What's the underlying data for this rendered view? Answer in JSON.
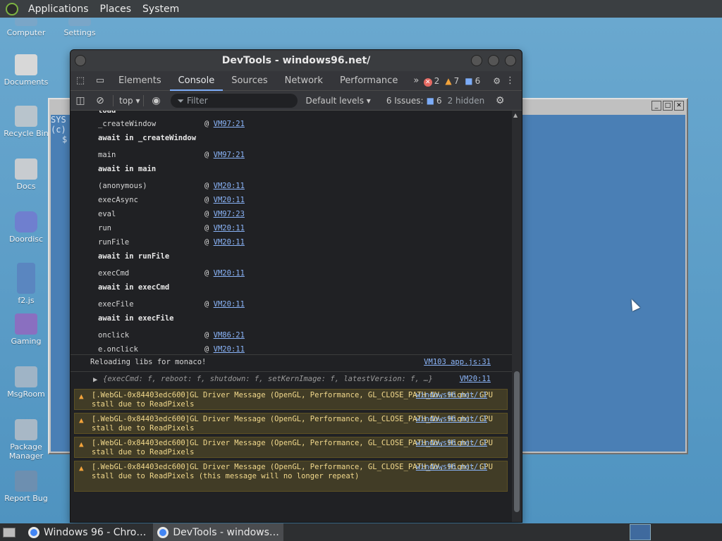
{
  "top_panel": {
    "menus": [
      "Applications",
      "Places",
      "System"
    ]
  },
  "desktop_icons": [
    {
      "label": "Computer"
    },
    {
      "label": "Settings"
    },
    {
      "label": "Documents"
    },
    {
      "label": "Recycle Bin"
    },
    {
      "label": "Docs"
    },
    {
      "label": "Doordisc"
    },
    {
      "label": "f2.js"
    },
    {
      "label": "Gaming"
    },
    {
      "label": "MsgRoom"
    },
    {
      "label": "Package Manager"
    },
    {
      "label": "Report Bug"
    }
  ],
  "w96_window": {
    "terminal_lines": [
      "SYS",
      "(c)",
      "",
      "$"
    ],
    "buttons": [
      "_",
      "□",
      "✕"
    ]
  },
  "devtools": {
    "title": "DevTools - windows96.net/",
    "tabs": [
      "Elements",
      "Console",
      "Sources",
      "Network",
      "Performance"
    ],
    "active_tab": "Console",
    "more_tabs": "»",
    "error_count": "2",
    "warning_count": "7",
    "info_count": "6",
    "toolbar": {
      "context": "top ▾",
      "filter_placeholder": "Filter",
      "levels": "Default levels ▾",
      "issues_label": "6 Issues:",
      "issues_count": "6",
      "hidden": "2 hidden"
    },
    "stack": [
      {
        "fn": "_createWindow",
        "link": "VM97:21"
      },
      {
        "await": "await in _createWindow"
      },
      {
        "fn": "main",
        "link": "VM97:21"
      },
      {
        "await": "await in main"
      },
      {
        "fn": "(anonymous)",
        "link": "VM20:11"
      },
      {
        "fn": "execAsync",
        "link": "VM20:11"
      },
      {
        "fn": "eval",
        "link": "VM97:23"
      },
      {
        "fn": "run",
        "link": "VM20:11"
      },
      {
        "fn": "runFile",
        "link": "VM20:11"
      },
      {
        "await": "await in runFile"
      },
      {
        "fn": "execCmd",
        "link": "VM20:11"
      },
      {
        "await": "await in execCmd"
      },
      {
        "fn": "execFile",
        "link": "VM20:11"
      },
      {
        "await": "await in execFile"
      },
      {
        "fn": "onclick",
        "link": "VM86:21"
      },
      {
        "fn": "e.onclick",
        "link": "VM20:11"
      }
    ],
    "reload_msg": {
      "text": "Reloading libs for monaco!",
      "src": "VM103 app.js:31"
    },
    "object_msg": {
      "text": "{execCmd: f, reboot: f, shutdown: f, setKernImage: f, latestVersion: f, …}",
      "src": "VM20:11"
    },
    "warnings": [
      {
        "text": "[.WebGL-0x84403edc600]GL Driver Message (OpenGL, Performance, GL_CLOSE_PATH_NV, High): GPU stall due to ReadPixels",
        "src": "windows96.net/:1"
      },
      {
        "text": "[.WebGL-0x84403edc600]GL Driver Message (OpenGL, Performance, GL_CLOSE_PATH_NV, High): GPU stall due to ReadPixels",
        "src": "windows96.net/:1"
      },
      {
        "text": "[.WebGL-0x84403edc600]GL Driver Message (OpenGL, Performance, GL_CLOSE_PATH_NV, High): GPU stall due to ReadPixels",
        "src": "windows96.net/:1"
      },
      {
        "text": "[.WebGL-0x84403edc600]GL Driver Message (OpenGL, Performance, GL_CLOSE_PATH_NV, High): GPU stall due to ReadPixels (this message will no longer repeat)",
        "src": "windows96.net/:1"
      }
    ],
    "prompt": "›"
  },
  "taskbar": {
    "items": [
      {
        "label": "Windows 96 - Chro…"
      },
      {
        "label": "DevTools - windows…"
      }
    ]
  }
}
